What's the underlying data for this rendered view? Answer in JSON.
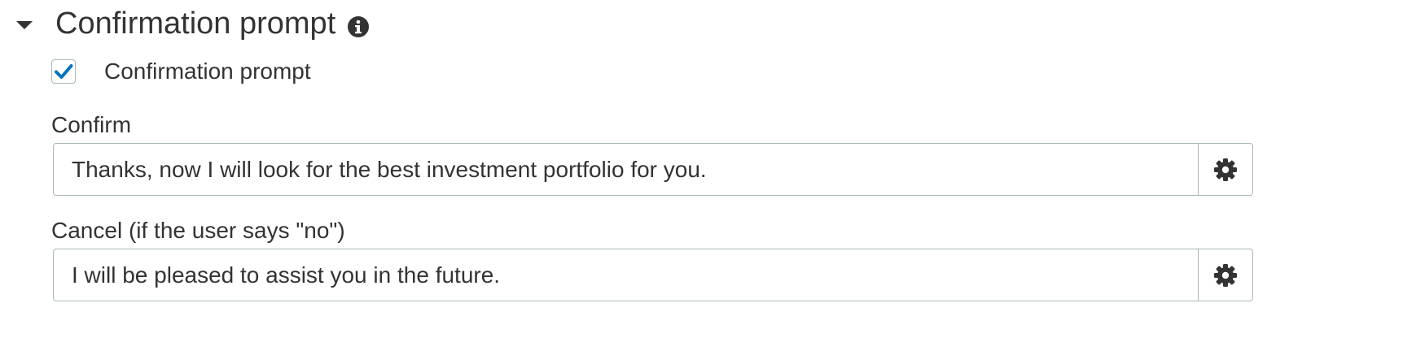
{
  "section": {
    "title": "Confirmation prompt",
    "info_icon": "info-circle-icon",
    "toggle_icon": "caret-down-icon"
  },
  "checkbox": {
    "label": "Confirmation prompt",
    "checked": true,
    "check_color": "#0073bb"
  },
  "confirm": {
    "label": "Confirm",
    "value": "Thanks, now I will look for the best investment portfolio for you.",
    "settings_icon": "gear-icon"
  },
  "cancel": {
    "label": "Cancel (if the user says \"no\")",
    "value": "I will be pleased to assist you in the future.",
    "settings_icon": "gear-icon"
  }
}
